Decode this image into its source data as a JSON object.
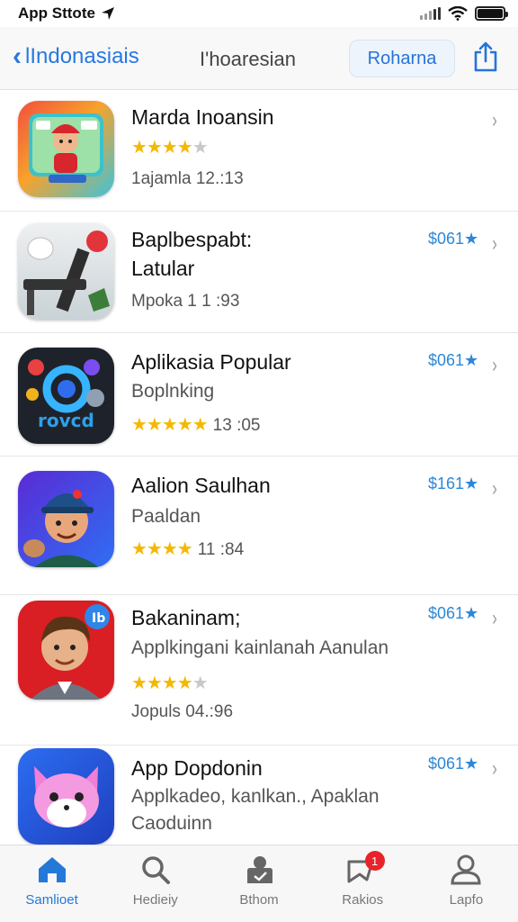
{
  "status_bar": {
    "carrier": "App Sttote"
  },
  "nav": {
    "back_label": "lIndonasiais",
    "title": "I'hoaresian",
    "action_label": "Roharna"
  },
  "apps": [
    {
      "name": "Marda Inoansin",
      "sub": "",
      "stars": 4,
      "meta": "1ajamla 12.:13",
      "price": ""
    },
    {
      "name": "Baplbespabt:",
      "sub": "Latular",
      "stars": 0,
      "meta": "Mpoka 1 1 :93",
      "price": "$061★"
    },
    {
      "name": "Aplikasia Popular",
      "sub": "Boplnking",
      "stars": 5,
      "meta": "13 :05",
      "price": "$061★"
    },
    {
      "name": "Aalion Saulhan",
      "sub": "Paaldan",
      "stars": 4,
      "meta": "11 :84",
      "price": "$161★"
    },
    {
      "name": "Bakaninam;",
      "sub": "Applkingani kainlanah Aanulan",
      "stars": 4,
      "meta": "Jopuls 04.:96",
      "price": "$061★"
    },
    {
      "name": "App Dopdonin",
      "sub": "Applkadeo, kanlkan., Apaklan",
      "sub2": "Caoduinn",
      "stars": 0,
      "meta": "",
      "price": "$061★"
    }
  ],
  "tabs": [
    {
      "label": "Samlioet",
      "icon": "home-icon",
      "active": true
    },
    {
      "label": "Hedieiy",
      "icon": "search-icon",
      "active": false
    },
    {
      "label": "Bthom",
      "icon": "apps-icon",
      "active": false
    },
    {
      "label": "Rakios",
      "icon": "updates-icon",
      "active": false,
      "badge": "1"
    },
    {
      "label": "Lapfo",
      "icon": "profile-icon",
      "active": false
    }
  ],
  "colors": {
    "accent": "#2478d8",
    "star": "#f5b800",
    "price": "#2d87d6",
    "badge": "#e8242a"
  }
}
